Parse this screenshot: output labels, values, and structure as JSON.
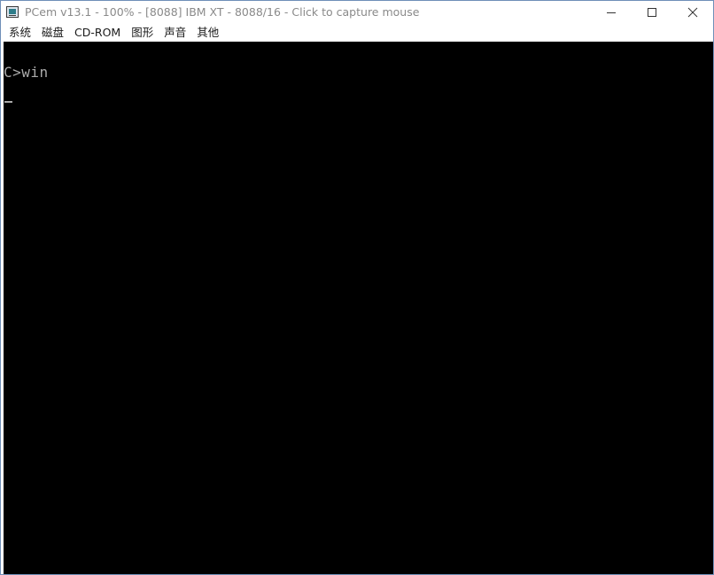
{
  "window": {
    "title": "PCem v13.1 - 100% - [8088] IBM XT - 8088/16 - Click to capture mouse"
  },
  "menu": [
    {
      "label": "系统"
    },
    {
      "label": "磁盘"
    },
    {
      "label": "CD-ROM"
    },
    {
      "label": "图形"
    },
    {
      "label": "声音"
    },
    {
      "label": "其他"
    }
  ],
  "emulator": {
    "prompt_line": "C>win",
    "cursor": "_",
    "background": "#000000",
    "text_color": "#aaaaaa"
  },
  "icons": {
    "app": "pcem-monitor-icon",
    "minimize": "minimize-icon",
    "maximize": "maximize-icon",
    "close": "close-icon"
  }
}
